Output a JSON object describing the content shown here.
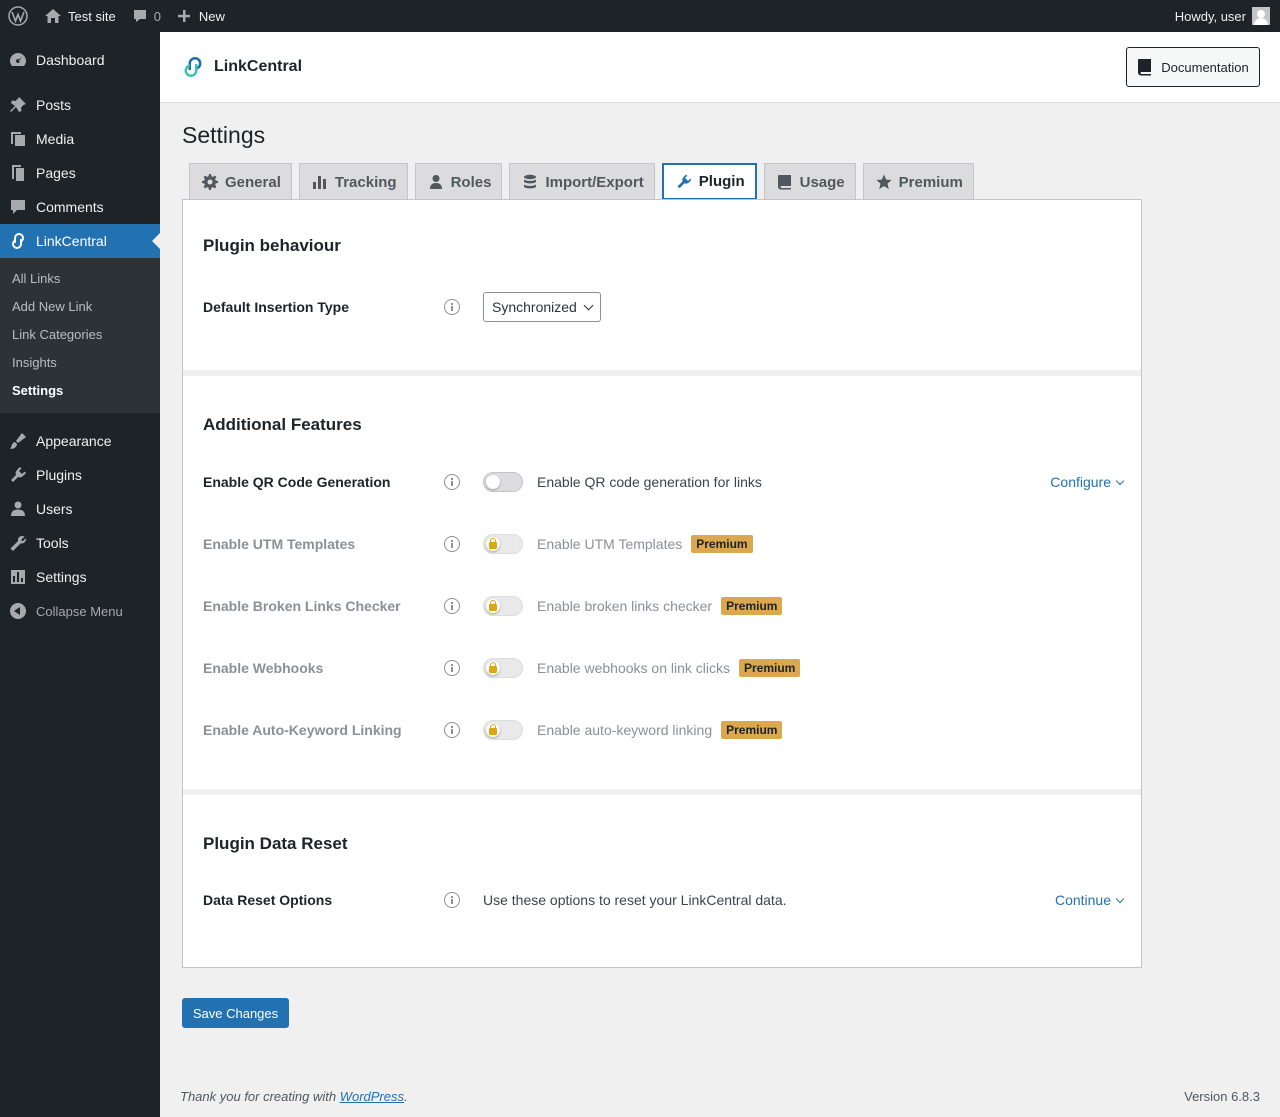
{
  "admin_bar": {
    "site_name": "Test site",
    "comments_count": "0",
    "new_label": "New",
    "greeting": "Howdy, user"
  },
  "sidebar": {
    "items": [
      {
        "label": "Dashboard",
        "icon": "dashboard-icon"
      },
      {
        "label": "Posts",
        "icon": "pin-icon"
      },
      {
        "label": "Media",
        "icon": "media-icon"
      },
      {
        "label": "Pages",
        "icon": "pages-icon"
      },
      {
        "label": "Comments",
        "icon": "comment-icon"
      },
      {
        "label": "LinkCentral",
        "icon": "link-icon"
      },
      {
        "label": "Appearance",
        "icon": "brush-icon"
      },
      {
        "label": "Plugins",
        "icon": "plugin-icon"
      },
      {
        "label": "Users",
        "icon": "users-icon"
      },
      {
        "label": "Tools",
        "icon": "wrench-icon"
      },
      {
        "label": "Settings",
        "icon": "settings-icon"
      }
    ],
    "submenu": [
      "All Links",
      "Add New Link",
      "Link Categories",
      "Insights",
      "Settings"
    ],
    "collapse_label": "Collapse Menu"
  },
  "header": {
    "title": "LinkCentral",
    "documentation_label": "Documentation"
  },
  "page": {
    "title": "Settings"
  },
  "tabs": [
    {
      "label": "General",
      "icon": "gear-icon"
    },
    {
      "label": "Tracking",
      "icon": "bar-chart-icon"
    },
    {
      "label": "Roles",
      "icon": "user-icon"
    },
    {
      "label": "Import/Export",
      "icon": "database-icon"
    },
    {
      "label": "Plugin",
      "icon": "plug-icon"
    },
    {
      "label": "Usage",
      "icon": "book-icon"
    },
    {
      "label": "Premium",
      "icon": "star-icon"
    }
  ],
  "behaviour": {
    "title": "Plugin behaviour",
    "insertion_label": "Default Insertion Type",
    "insertion_value": "Synchronized"
  },
  "features": {
    "title": "Additional Features",
    "qr": {
      "label": "Enable QR Code Generation",
      "desc": "Enable QR code generation for links",
      "link": "Configure"
    },
    "utm": {
      "label": "Enable UTM Templates",
      "desc": "Enable UTM Templates",
      "badge": "Premium"
    },
    "broken": {
      "label": "Enable Broken Links Checker",
      "desc": "Enable broken links checker",
      "badge": "Premium"
    },
    "webhooks": {
      "label": "Enable Webhooks",
      "desc": "Enable webhooks on link clicks",
      "badge": "Premium"
    },
    "autokeyword": {
      "label": "Enable Auto-Keyword Linking",
      "desc": "Enable auto-keyword linking",
      "badge": "Premium"
    }
  },
  "reset": {
    "title": "Plugin Data Reset",
    "label": "Data Reset Options",
    "desc": "Use these options to reset your LinkCentral data.",
    "link": "Continue"
  },
  "save_label": "Save Changes",
  "footer": {
    "thanks_prefix": "Thank you for creating with ",
    "wp_link": "WordPress",
    "thanks_suffix": ".",
    "version": "Version 6.8.3"
  },
  "colors": {
    "accent": "#2271b1",
    "admin_dark": "#1d2327",
    "premium_badge": "#dba74f"
  }
}
